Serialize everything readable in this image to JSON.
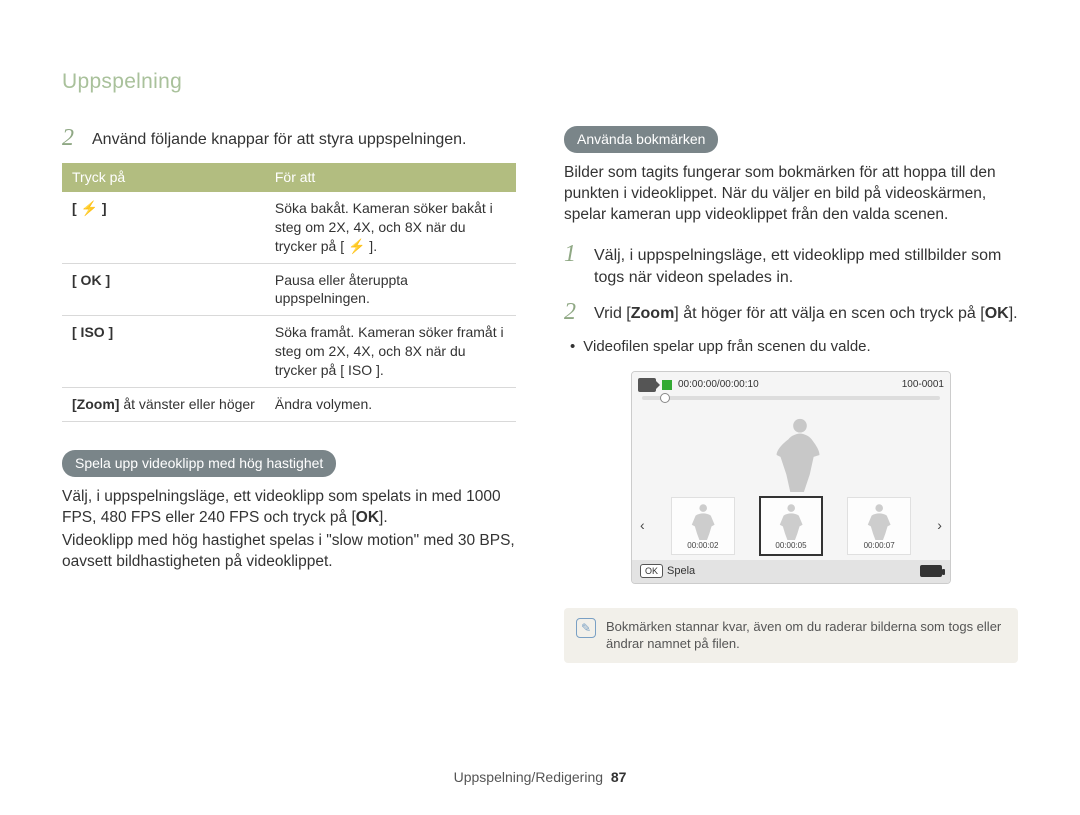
{
  "header": {
    "title": "Uppspelning"
  },
  "left": {
    "step2_num": "2",
    "step2_text": "Använd följande knappar för att styra uppspelningen.",
    "table": {
      "h1": "Tryck på",
      "h2": "För att",
      "rows": [
        {
          "k": "[ ⚡ ]",
          "v": "Söka bakåt. Kameran söker bakåt i steg om 2X, 4X, och 8X när du trycker på [ ⚡ ]."
        },
        {
          "k": "[ OK ]",
          "v": "Pausa eller återuppta uppspelningen."
        },
        {
          "k": "[ ISO ]",
          "v": "Söka framåt. Kameran söker framåt i steg om 2X, 4X, och 8X när du trycker på [ ISO ]."
        },
        {
          "k": "[Zoom] åt vänster eller höger",
          "v": "Ändra volymen."
        }
      ]
    },
    "pill1": "Spela upp videoklipp med hög hastighet",
    "body1a": "Välj, i uppspelningsläge, ett videoklipp som spelats in med 1000 FPS, 480 FPS eller 240 FPS och tryck på [",
    "body1b": "OK",
    "body1c": "].",
    "body2": "Videoklipp med hög hastighet spelas i \"slow motion\" med 30 BPS, oavsett bildhastigheten på videoklippet."
  },
  "right": {
    "pill1": "Använda bokmärken",
    "intro": "Bilder som tagits fungerar som bokmärken för att hoppa till den punkten i videoklippet. När du väljer en bild på videoskärmen, spelar kameran upp videoklippet från den valda scenen.",
    "step1_num": "1",
    "step1_text": "Välj, i uppspelningsläge, ett videoklipp med stillbilder som togs när videon spelades in.",
    "step2_num": "2",
    "step2_a": "Vrid [",
    "step2_b": "Zoom",
    "step2_c": "] åt höger för att välja en scen och tryck på [",
    "step2_d": "OK",
    "step2_e": "].",
    "bullet1": "Videofilen spelar upp från scenen du valde.",
    "cam": {
      "time": "00:00:00/00:00:10",
      "file": "100-0001",
      "thumbs": [
        "00:00:02",
        "00:00:05",
        "00:00:07"
      ],
      "ok": "OK",
      "play": "Spela"
    },
    "note": "Bokmärken stannar kvar, även om du raderar bilderna som togs eller ändrar namnet på filen."
  },
  "footer": {
    "section": "Uppspelning/Redigering",
    "page": "87"
  }
}
